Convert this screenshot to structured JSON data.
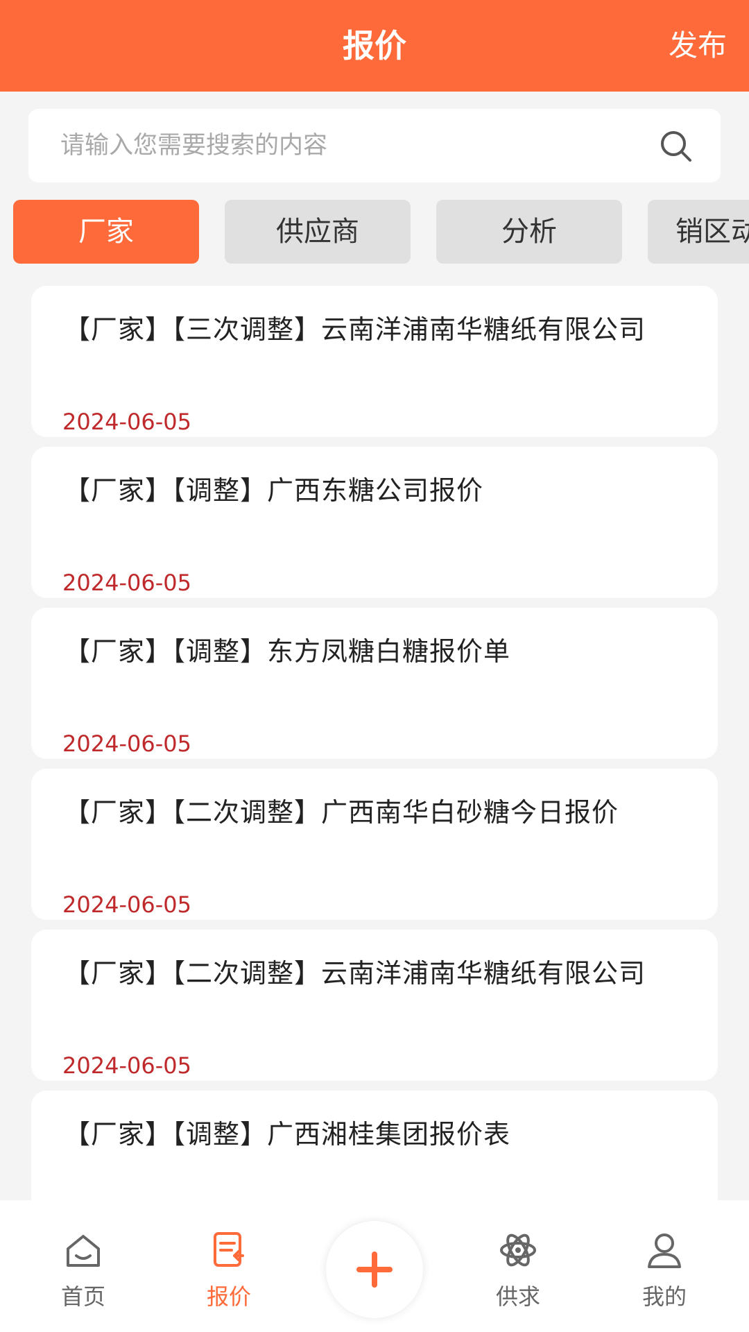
{
  "header": {
    "title": "报价",
    "publish": "发布"
  },
  "search": {
    "placeholder": "请输入您需要搜索的内容"
  },
  "tabs": [
    {
      "label": "厂家",
      "active": true
    },
    {
      "label": "供应商",
      "active": false
    },
    {
      "label": "分析",
      "active": false
    },
    {
      "label": "销区动",
      "active": false
    }
  ],
  "items": [
    {
      "title": "【厂家】【三次调整】云南洋浦南华糖纸有限公司",
      "date": "2024-06-05"
    },
    {
      "title": "【厂家】【调整】广西东糖公司报价",
      "date": "2024-06-05"
    },
    {
      "title": "【厂家】【调整】东方凤糖白糖报价单",
      "date": "2024-06-05"
    },
    {
      "title": "【厂家】【二次调整】广西南华白砂糖今日报价",
      "date": "2024-06-05"
    },
    {
      "title": "【厂家】【二次调整】云南洋浦南华糖纸有限公司",
      "date": "2024-06-05"
    },
    {
      "title": "【厂家】【调整】广西湘桂集团报价表",
      "date": ""
    }
  ],
  "nav": [
    {
      "label": "首页",
      "icon": "home-icon",
      "active": false
    },
    {
      "label": "报价",
      "icon": "quote-icon",
      "active": true
    },
    {
      "label": "供求",
      "icon": "supply-demand-icon",
      "active": false
    },
    {
      "label": "我的",
      "icon": "user-icon",
      "active": false
    }
  ],
  "colors": {
    "brand": "#ff6a3a",
    "date": "#c0292b",
    "tab_inactive": "#e0e0e0"
  }
}
